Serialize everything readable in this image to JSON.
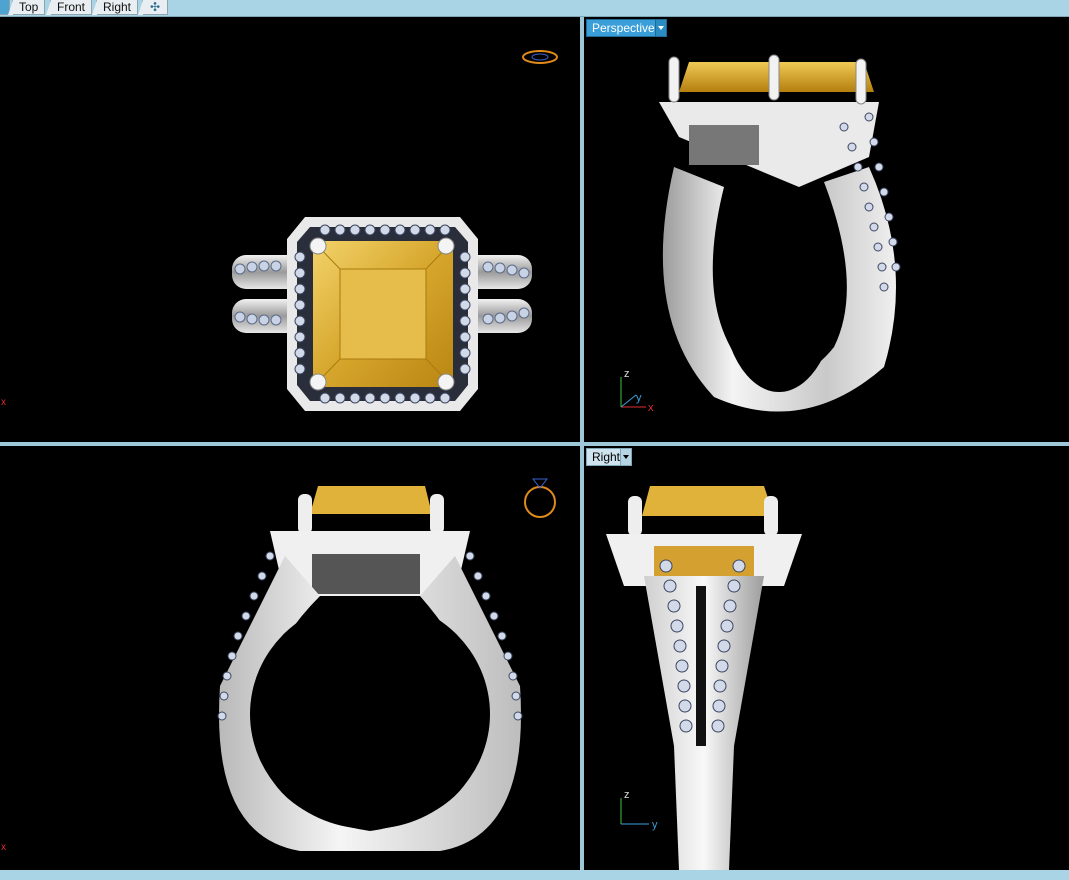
{
  "tabs": [
    {
      "label": "Top"
    },
    {
      "label": "Front"
    },
    {
      "label": "Right"
    }
  ],
  "tab_add_icon": "plus-icon",
  "viewports": {
    "perspective": {
      "label": "Perspective"
    },
    "right": {
      "label": "Right"
    }
  },
  "axes": {
    "x": "x",
    "y": "y",
    "z": "z"
  },
  "colors": {
    "background": "#000000",
    "metal": "#d9d9d9",
    "gem": "#e0b23a",
    "accent": "#3a9fd8"
  }
}
